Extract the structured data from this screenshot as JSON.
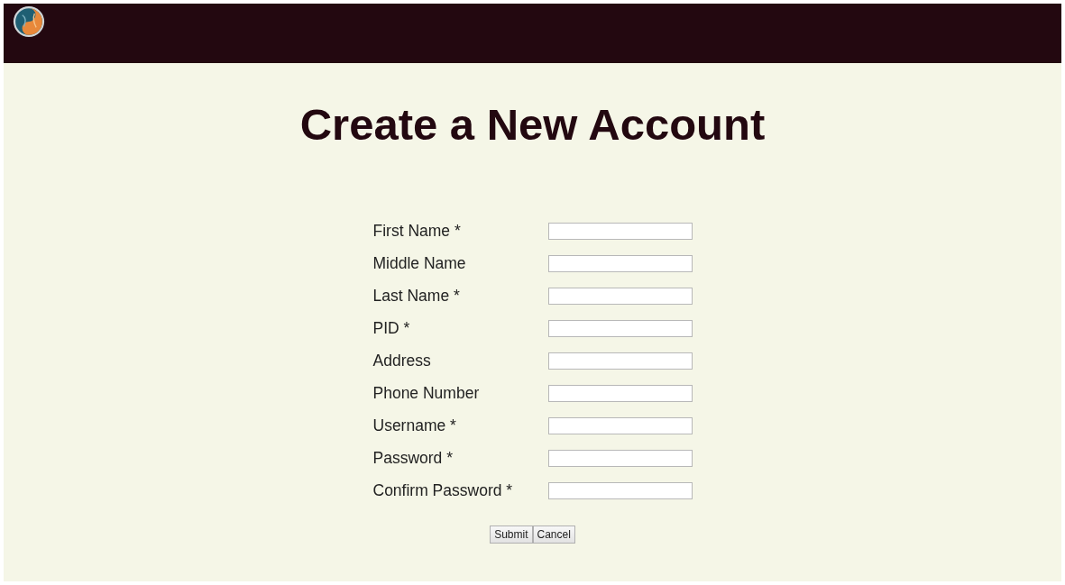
{
  "title": "Create a New Account",
  "fields": [
    {
      "label": "First Name *"
    },
    {
      "label": "Middle Name"
    },
    {
      "label": "Last Name *"
    },
    {
      "label": "PID *"
    },
    {
      "label": "Address"
    },
    {
      "label": "Phone Number"
    },
    {
      "label": "Username *"
    },
    {
      "label": "Password *"
    },
    {
      "label": "Confirm Password *"
    }
  ],
  "buttons": [
    "Submit",
    "Cancel"
  ]
}
